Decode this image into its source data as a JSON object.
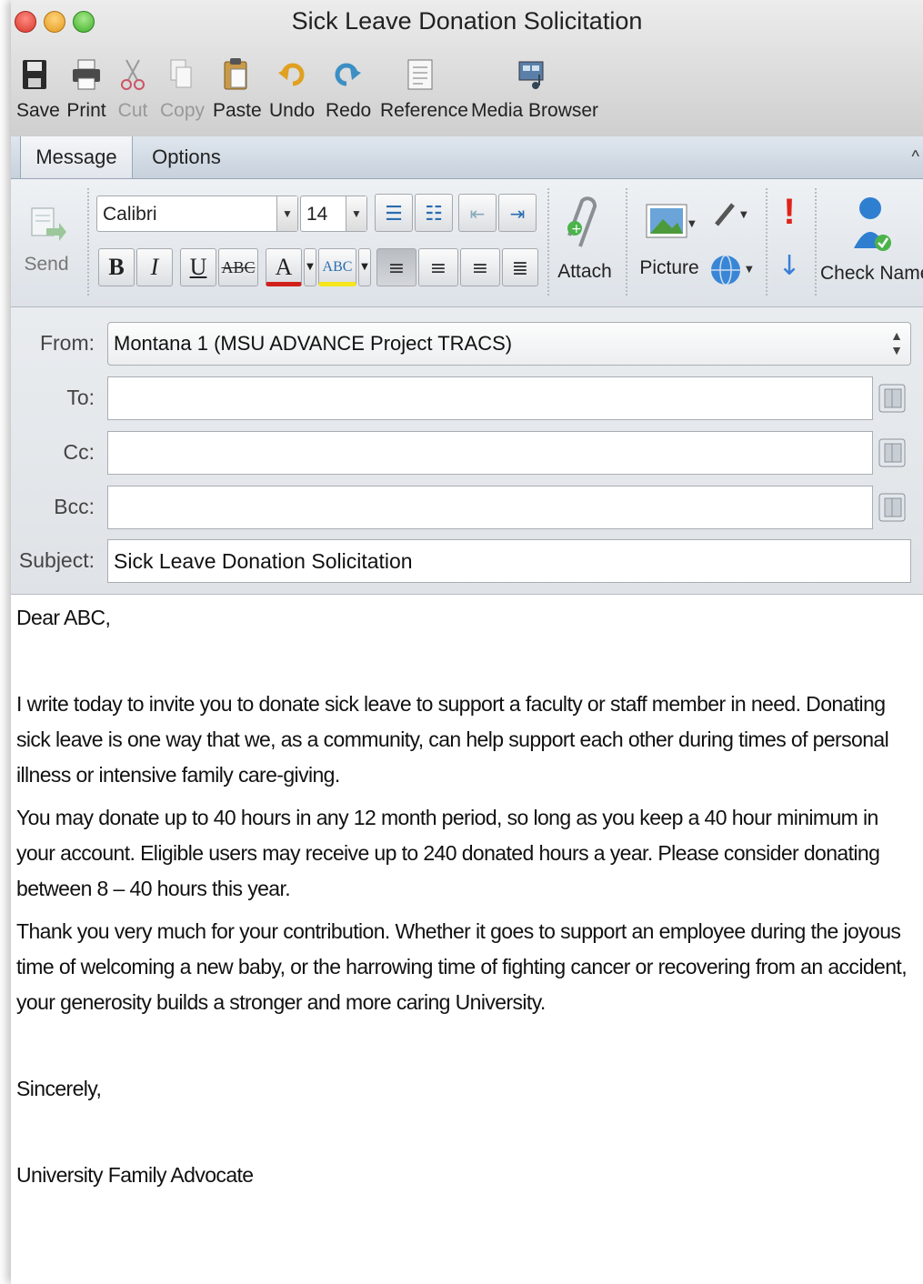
{
  "window": {
    "title": "Sick Leave Donation Solicitation"
  },
  "toolbar": {
    "save": "Save",
    "print": "Print",
    "cut": "Cut",
    "copy": "Copy",
    "paste": "Paste",
    "undo": "Undo",
    "redo": "Redo",
    "reference": "Reference",
    "media_browser": "Media Browser"
  },
  "tabs": [
    {
      "label": "Message",
      "active": true
    },
    {
      "label": "Options",
      "active": false
    }
  ],
  "ribbon": {
    "send": "Send",
    "font_name": "Calibri",
    "font_size": "14",
    "bold": "B",
    "italic": "I",
    "underline": "U",
    "strikethrough": "ABC",
    "font_color_glyph": "A",
    "highlight_glyph": "ABC",
    "attach": "Attach",
    "picture": "Picture",
    "check_names": "Check Names",
    "colors": {
      "font_color": "#d0201a",
      "highlight": "#f5e51a",
      "priority_high": "#e0221a",
      "priority_low": "#3a7fd6"
    }
  },
  "header": {
    "from_label": "From:",
    "from_value": "Montana 1 (MSU ADVANCE Project TRACS)",
    "to_label": "To:",
    "to_value": "",
    "cc_label": "Cc:",
    "cc_value": "",
    "bcc_label": "Bcc:",
    "bcc_value": "",
    "subject_label": "Subject:",
    "subject_value": "Sick Leave Donation Solicitation"
  },
  "body": {
    "greeting": "Dear  ABC,",
    "paragraph1": "I write today to invite you to donate sick leave to support a faculty or staff member in need. Donating sick leave is one way that we, as a community, can help support each other during times of personal illness or intensive family care-giving.",
    "paragraph2": "You may donate up to 40 hours in any 12 month period, so long as you keep a 40 hour minimum in your account. Eligible users may receive up to 240 donated hours a year. Please consider donating between 8 – 40 hours this year.",
    "paragraph3": "Thank you very much for your contribution. Whether it goes to support an employee during the joyous time of welcoming a new baby, or the harrowing time of fighting cancer or recovering from an accident, your generosity builds a stronger and more caring University.",
    "closing": "Sincerely,",
    "signature": "University Family Advocate"
  }
}
